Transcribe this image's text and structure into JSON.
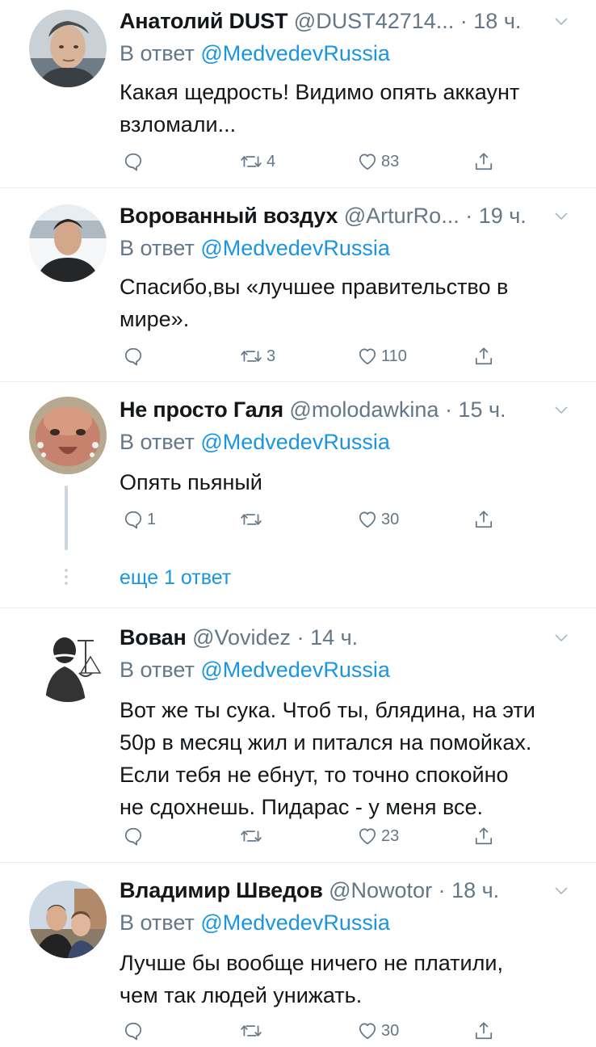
{
  "tweets": [
    {
      "name": "Анатолий DUST",
      "handle": "@DUST42714...",
      "time": "· 18 ч.",
      "reply_prefix": "В ответ",
      "reply_to": "@MedvedevRussia",
      "text_lines": [
        "Какая щедрость! Видимо опять аккаунт",
        "взломали..."
      ],
      "replies": "",
      "retweets": "4",
      "likes": "83"
    },
    {
      "name": "Ворованный воздух",
      "handle": "@ArturRo...",
      "time": "· 19 ч.",
      "reply_prefix": "В ответ",
      "reply_to": "@MedvedevRussia",
      "text_lines": [
        "Спасибо,вы «лучшее правительство в",
        "мире»."
      ],
      "replies": "",
      "retweets": "3",
      "likes": "110"
    },
    {
      "name": "Не просто Галя",
      "handle": "@molodawkina",
      "time": "· 15 ч.",
      "reply_prefix": "В ответ",
      "reply_to": "@MedvedevRussia",
      "text_lines": [
        "Опять пьяный"
      ],
      "replies": "1",
      "retweets": "",
      "likes": "30",
      "more_replies": "еще 1 ответ"
    },
    {
      "name": "Вован",
      "handle": "@Vovidez",
      "time": "· 14 ч.",
      "reply_prefix": "В ответ",
      "reply_to": "@MedvedevRussia",
      "text_lines": [
        "Вот же ты сука. Чтоб ты, блядина, на эти",
        "50р в месяц жил и питался на помойках.",
        "Если тебя не ебнут, то точно спокойно",
        "не сдохнешь. Пидарас - у меня все."
      ],
      "replies": "",
      "retweets": "",
      "likes": "23"
    },
    {
      "name": "Владимир Шведов",
      "handle": "@Nowotor",
      "time": "· 18 ч.",
      "reply_prefix": "В ответ",
      "reply_to": "@MedvedevRussia",
      "text_lines": [
        "Лучше бы вообще ничего не платили,",
        "чем так людей унижать."
      ],
      "replies": "",
      "retweets": "",
      "likes": "30"
    }
  ],
  "icons": {
    "reply": "reply-icon",
    "retweet": "retweet-icon",
    "like": "heart-icon",
    "share": "share-icon",
    "caret": "chevron-down-icon"
  },
  "colors": {
    "mention": "#1b95e0",
    "meta": "#657786",
    "text": "#14171a",
    "divider": "#e6ecf0"
  }
}
